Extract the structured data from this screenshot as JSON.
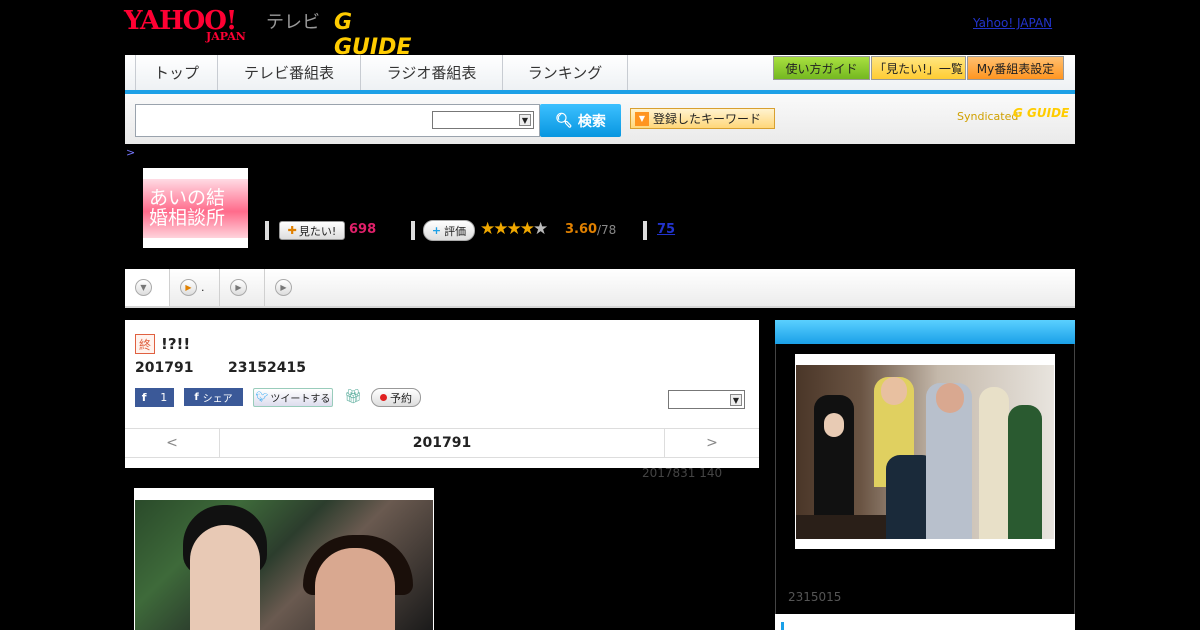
{
  "header": {
    "yahoo_logo_main": "YAHOO!",
    "yahoo_logo_sub": "JAPAN",
    "tv_label": "テレビ",
    "gguide_logo": "G GUIDE",
    "yahoo_japan_link": "Yahoo! JAPAN"
  },
  "nav": {
    "tabs": [
      "トップ",
      "テレビ番組表",
      "ラジオ番組表",
      "ランキング"
    ],
    "guide_button": "使い方ガイド",
    "mitai_list_button": "「見たい!」一覧",
    "my_button": "My番組表設定"
  },
  "search": {
    "input_value": "",
    "select_value": "",
    "button_label": "検索",
    "keyword_button": "登録したキーワード",
    "syndicated_label": "Syndicated",
    "syndicated_logo": "G GUIDE"
  },
  "breadcrumb": ">",
  "program": {
    "thumb_text": "あいの結婚相談所",
    "mitai_label": "見たい!",
    "mitai_count": "698",
    "hyoka_label": "評価",
    "rating_score": "3.60",
    "rating_count": "/78",
    "rating_stars": 3.6,
    "review_count": "75"
  },
  "tabs": [
    {
      "icon": "chevron-down-icon",
      "label": ""
    },
    {
      "icon": "play-icon",
      "label": "."
    },
    {
      "icon": "play-icon",
      "label": ""
    },
    {
      "icon": "play-icon",
      "label": ""
    }
  ],
  "episode": {
    "end_badge": "終",
    "title": "!?!!",
    "date": "201791",
    "time": "23152415",
    "fb_like_count": "1",
    "fb_share_label": "シェア",
    "tweet_label": "ツイートする",
    "yoyaku_label": "予約",
    "select_value": "",
    "pager_prev": "<",
    "pager_date": "201791",
    "pager_next": ">",
    "update_note": "2017831  140"
  },
  "side": {
    "note": "2315015"
  },
  "colors": {
    "accent_blue": "#1da0e6",
    "yahoo_red": "#ff0033",
    "gguide_yellow": "#ffcc00",
    "mitai_pink": "#e0206a"
  }
}
